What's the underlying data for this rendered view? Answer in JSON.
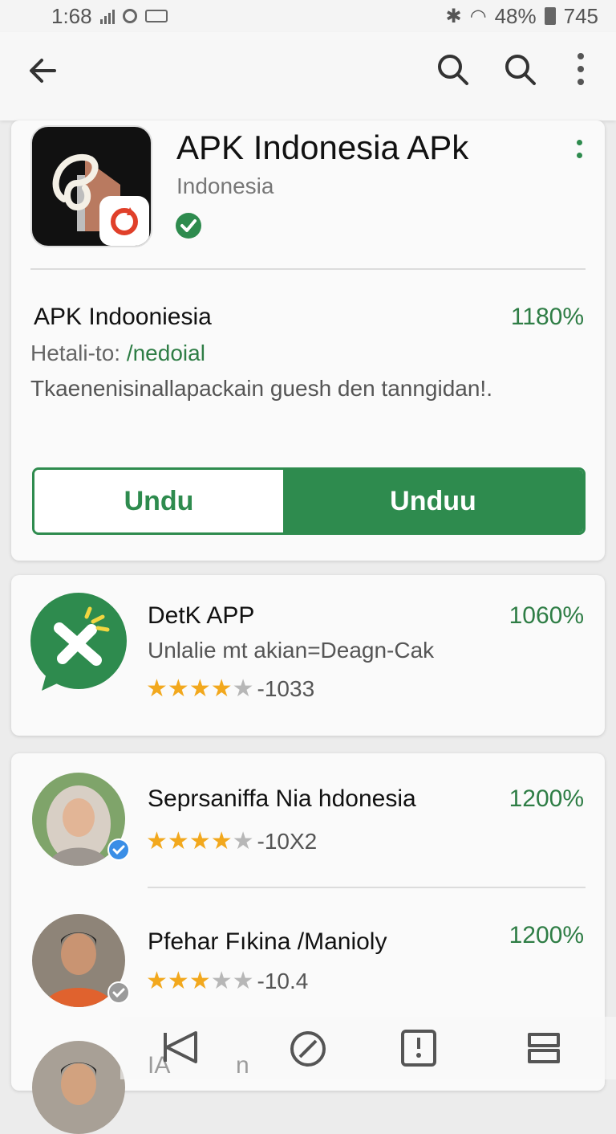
{
  "status_bar": {
    "time": "1:68",
    "battery": "48%",
    "extra": "745"
  },
  "header": {
    "back_label": "back",
    "search_label": "search",
    "search2_label": "search",
    "menu_label": "more"
  },
  "app": {
    "title": "APK Indonesia APk",
    "developer": "Indonesia",
    "name": "APK Indooniesia",
    "percent": "1180%",
    "related_prefix": "Hetali-to:",
    "related_link": "/nedoial",
    "description": "Tkaenenisinallapackain guesh den tanngidan!.",
    "button_left": "Undu",
    "button_right": "Unduu"
  },
  "list_card": {
    "name": "DetK APP",
    "subtitle": "Unlalie mt akian=Deagn-Cak",
    "percent": "1060%",
    "rating": 4,
    "count": "-1033"
  },
  "people": [
    {
      "name": "Seprsaniffa Nia hdonesia",
      "percent": "1200%",
      "rating": 4,
      "count": "-10X2"
    },
    {
      "name": "Pfehar Fıkina /Manioly",
      "percent": "1200%",
      "rating": 3,
      "count": "-10.4"
    },
    {
      "name": "IA",
      "suffix": "n"
    }
  ],
  "colors": {
    "accent_green": "#2e8b4e",
    "star": "#f2a81d"
  }
}
